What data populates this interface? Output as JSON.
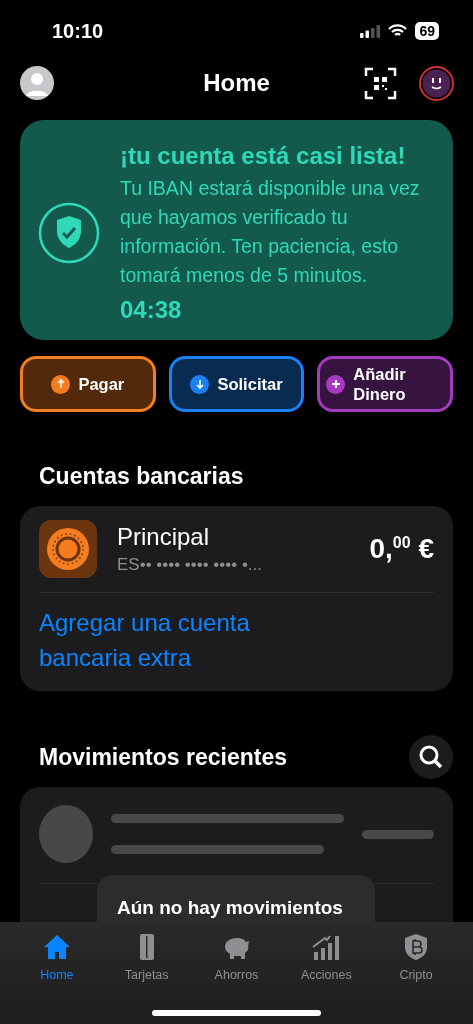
{
  "status_bar": {
    "time": "10:10",
    "battery": "69"
  },
  "header": {
    "title": "Home"
  },
  "banner": {
    "title": "¡tu cuenta está casi lista!",
    "message": "Tu IBAN estará disponible una vez que hayamos verificado tu información. Ten paciencia, esto tomará menos de 5 minutos.",
    "timer": "04:38"
  },
  "actions": [
    {
      "kind": "up",
      "label": "Pagar",
      "color": "#f57c1f"
    },
    {
      "kind": "down",
      "label": "Solicitar",
      "color": "#1a82f5"
    },
    {
      "kind": "plus",
      "label": "Añadir Dinero",
      "color": "#a53bc0"
    }
  ],
  "accounts": {
    "title": "Cuentas bancarias",
    "items": [
      {
        "name": "Principal",
        "iban": "ES•• •••• •••• •••• •...",
        "balance": "0,$^{00}$ €"
      }
    ],
    "add_link": "Agregar una cuenta bancaria extra"
  },
  "movements": {
    "title": "Movimientos recientes",
    "empty_message": "Aún no hay movimientos"
  },
  "tab_bar": [
    {
      "kind": "home",
      "label": "Home",
      "selected": true
    },
    {
      "kind": "card",
      "label": "Tarjetas",
      "selected": false
    },
    {
      "kind": "piggy",
      "label": "Ahorros",
      "selected": false
    },
    {
      "kind": "chart",
      "label": "Acciones",
      "selected": false
    },
    {
      "kind": "bitcoin",
      "label": "Cripto",
      "selected": false
    }
  ]
}
